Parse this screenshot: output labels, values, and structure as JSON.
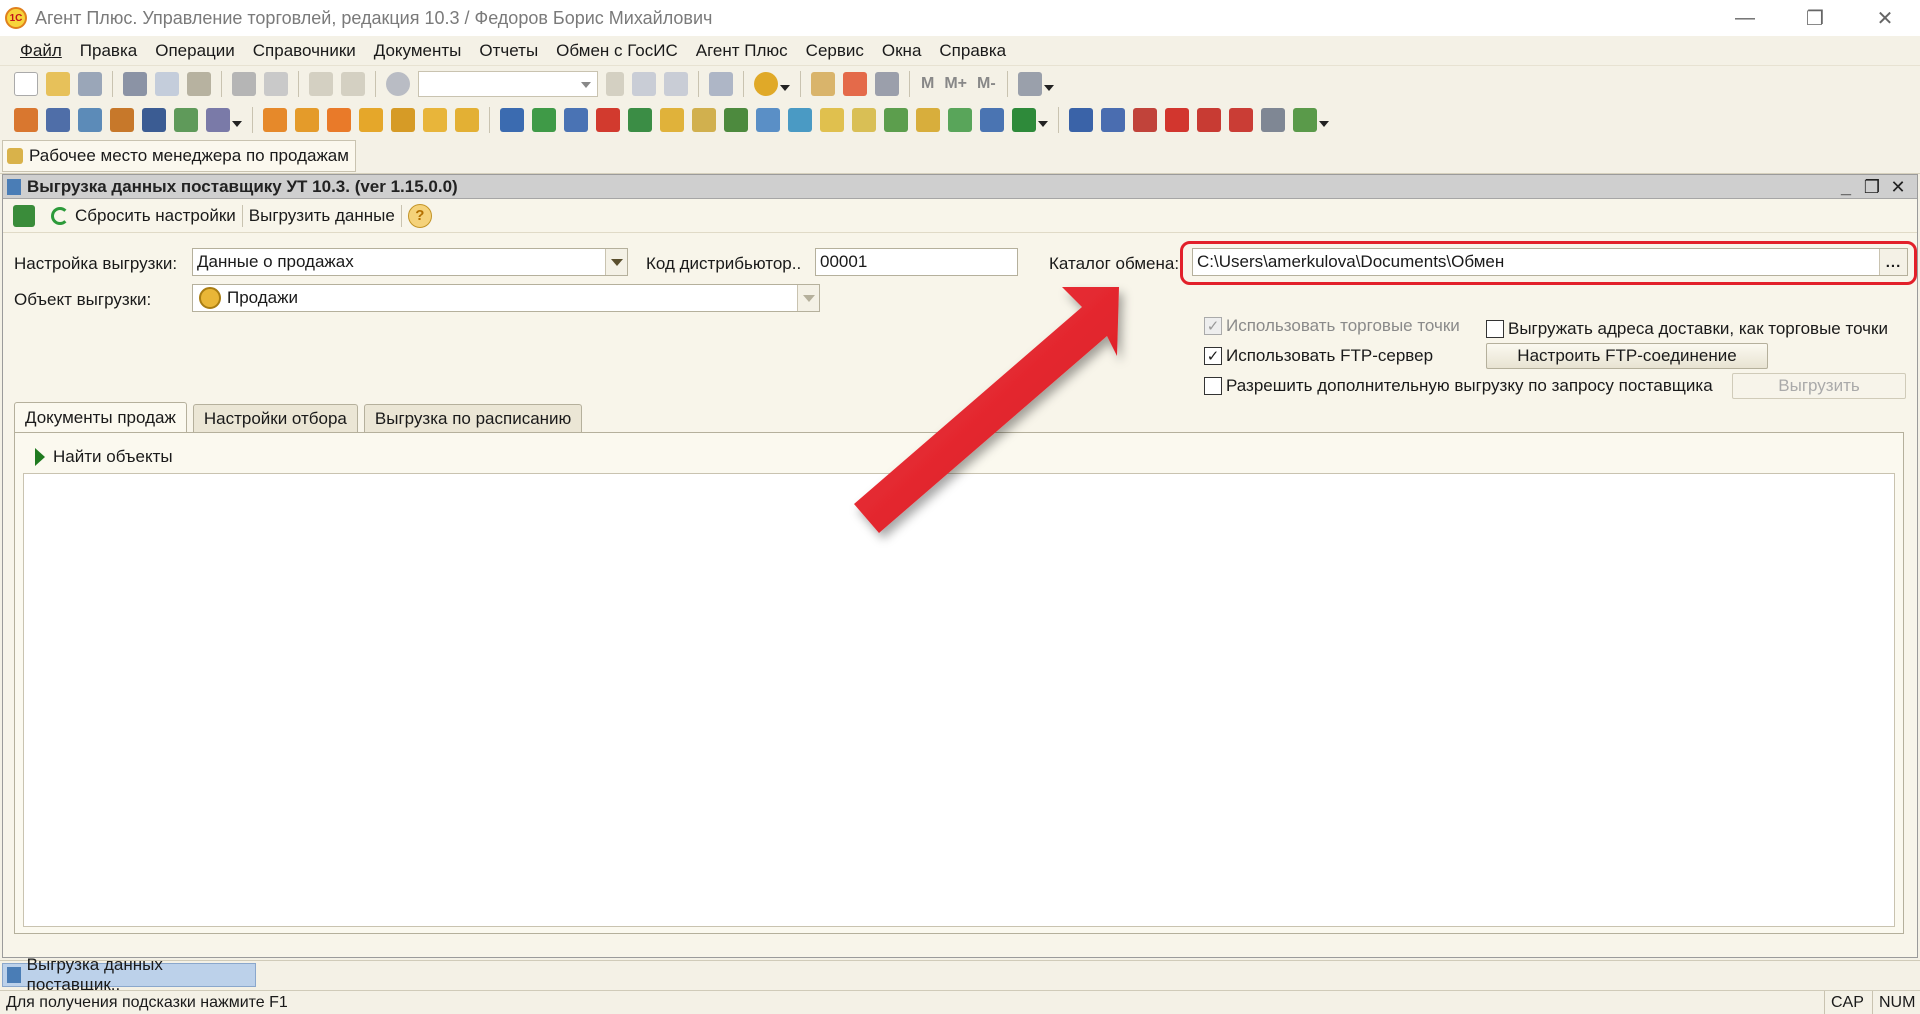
{
  "window": {
    "title": "Агент Плюс. Управление торговлей, редакция 10.3 / Федоров Борис Михайлович",
    "logo": "1С"
  },
  "menu": [
    "Файл",
    "Правка",
    "Операции",
    "Справочники",
    "Документы",
    "Отчеты",
    "Обмен с ГосИС",
    "Агент Плюс",
    "Сервис",
    "Окна",
    "Справка"
  ],
  "toolbar": {
    "memory_buttons": [
      "M",
      "M+",
      "M-"
    ]
  },
  "panel": {
    "workplace_button": "Рабочее место менеджера по продажам"
  },
  "document": {
    "title": "Выгрузка данных поставщику УТ 10.3. (ver 1.15.0.0)",
    "toolbar": {
      "reset_label": "Сбросить настройки",
      "export_label": "Выгрузить данные",
      "help_label": "?"
    },
    "form": {
      "setting_label": "Настройка выгрузки:",
      "setting_value": "Данные о продажах",
      "object_label": "Объект выгрузки:",
      "object_value": "Продажи",
      "distributor_label": "Код дистрибьютор..",
      "distributor_value": "00001",
      "catalog_label": "Каталог обмена:",
      "catalog_value": "C:\\Users\\amerkulova\\Documents\\Обмен",
      "browse_label": "..."
    },
    "options": {
      "use_trade_points": "Использовать торговые точки",
      "use_ftp": "Использовать FTP-сервер",
      "allow_extra": "Разрешить дополнительную выгрузку по запросу поставщика",
      "export_delivery": "Выгружать адреса доставки, как торговые точки",
      "ftp_button": "Настроить FTP-соединение",
      "export_button": "Выгрузить"
    },
    "tabs": [
      "Документы продаж",
      "Настройки отбора",
      "Выгрузка по расписанию"
    ],
    "find_objects": "Найти объекты"
  },
  "taskbar": {
    "item": "Выгрузка данных поставщик.."
  },
  "status": {
    "hint": "Для получения подсказки нажмите F1",
    "cap": "CAP",
    "num": "NUM"
  },
  "colors": {
    "highlight": "#e2202a",
    "arrow": "#e2202a",
    "background": "#f4f1e6"
  }
}
